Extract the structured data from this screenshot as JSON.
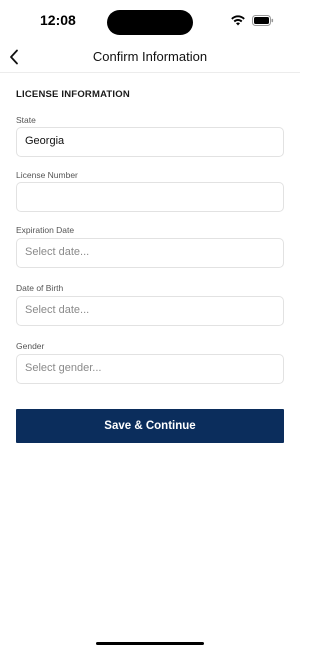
{
  "status_bar": {
    "time": "12:08"
  },
  "nav": {
    "title": "Confirm Information",
    "back_icon": "chevron-left-icon"
  },
  "form": {
    "section_title": "LICENSE INFORMATION",
    "fields": {
      "state": {
        "label": "State",
        "value": "Georgia"
      },
      "license_number": {
        "label": "License Number",
        "value": ""
      },
      "expiration_date": {
        "label": "Expiration Date",
        "placeholder": "Select date..."
      },
      "date_of_birth": {
        "label": "Date of Birth",
        "placeholder": "Select date..."
      },
      "gender": {
        "label": "Gender",
        "placeholder": "Select gender..."
      }
    },
    "submit_label": "Save & Continue"
  },
  "colors": {
    "primary_button": "#0b2d5c"
  }
}
